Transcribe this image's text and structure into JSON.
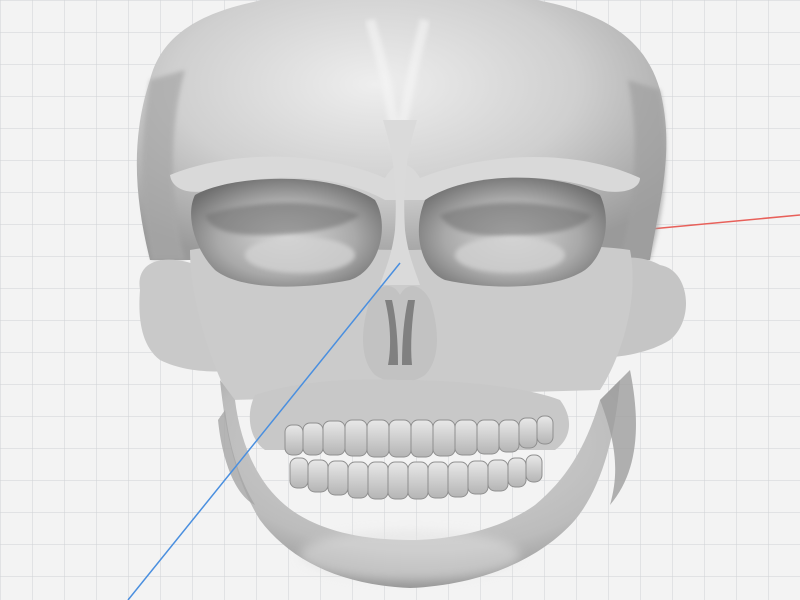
{
  "viewport": {
    "background_color": "#f3f3f3",
    "grid_line_color": "#cfd1d4",
    "axes": {
      "x_axis_color": "#e8605a",
      "y_axis_color": "#4a8fdf"
    }
  },
  "model": {
    "name": "skull-mesh",
    "surface_color": "#c6c6c6",
    "shadow_color": "#7d7d7d",
    "highlight_color": "#ececec"
  }
}
